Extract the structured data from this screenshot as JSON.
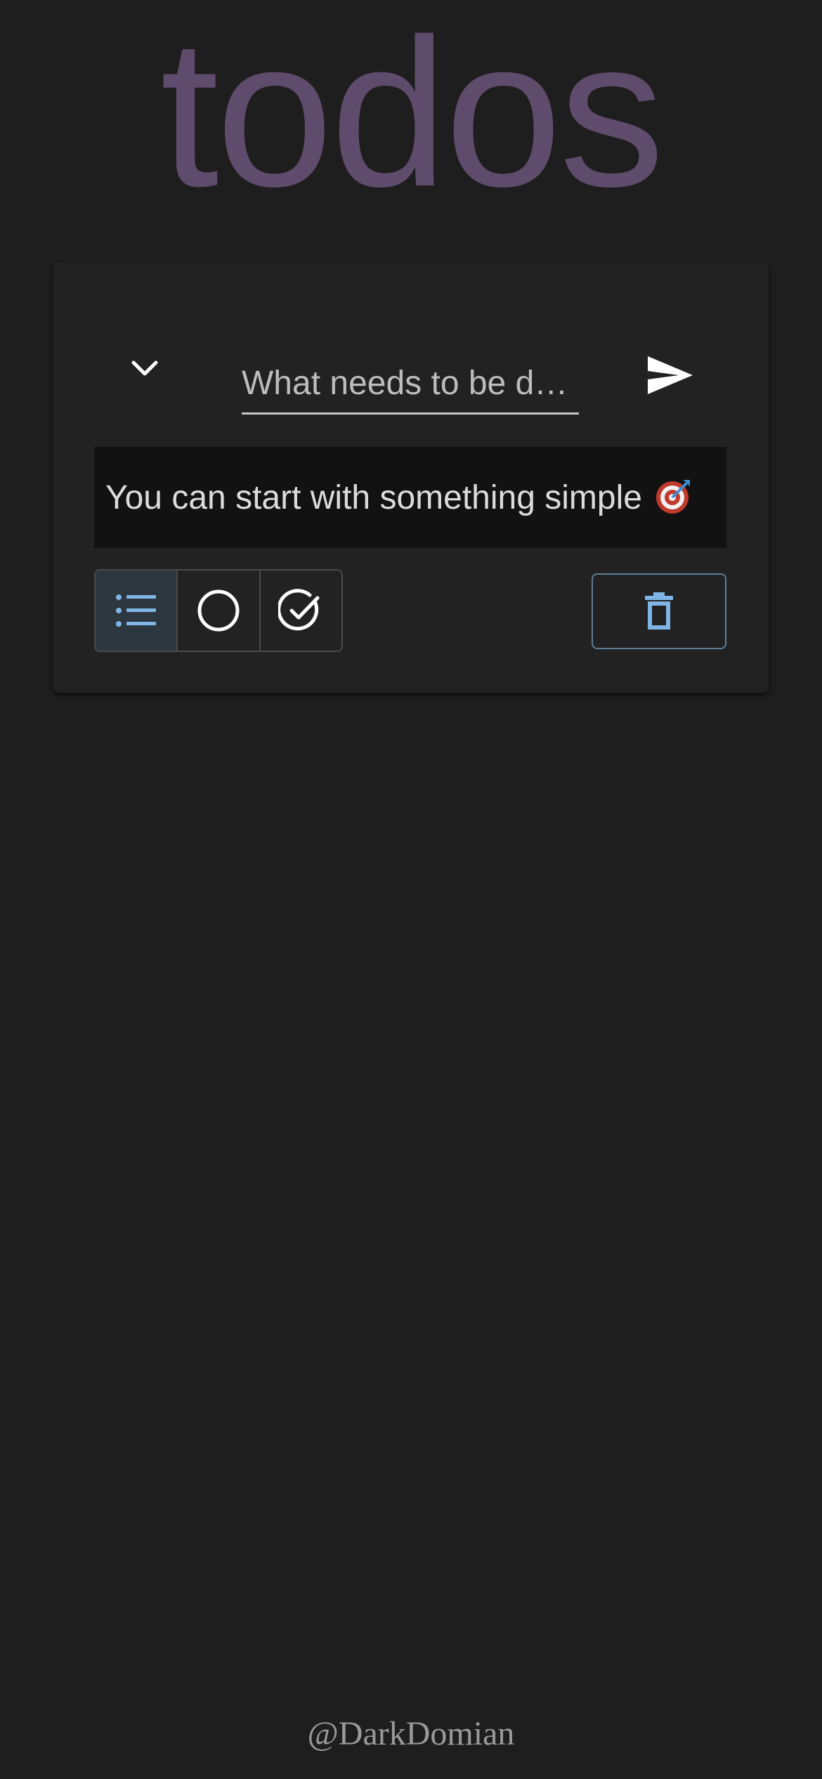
{
  "header": {
    "title": "todos"
  },
  "new_todo": {
    "placeholder": "What needs to be do…",
    "value": ""
  },
  "hint": {
    "text": "You can start with something simple"
  },
  "filters": {
    "selected": "all",
    "items": [
      {
        "id": "all",
        "icon": "list-icon"
      },
      {
        "id": "active",
        "icon": "circle-icon"
      },
      {
        "id": "completed",
        "icon": "check-circle-icon"
      }
    ]
  },
  "icons": {
    "toggle_all": "chevron-down-icon",
    "send": "send-icon",
    "clear_completed": "trash-icon",
    "hint_emoji": "target-icon"
  },
  "colors": {
    "background": "#1e1e1e",
    "card": "#222222",
    "title": "#5f4c6c",
    "accent": "#7fb6e6",
    "selected_filter_bg": "#2c3740",
    "clear_border": "#5b7d96"
  },
  "footer": {
    "credit": "@DarkDomian"
  }
}
